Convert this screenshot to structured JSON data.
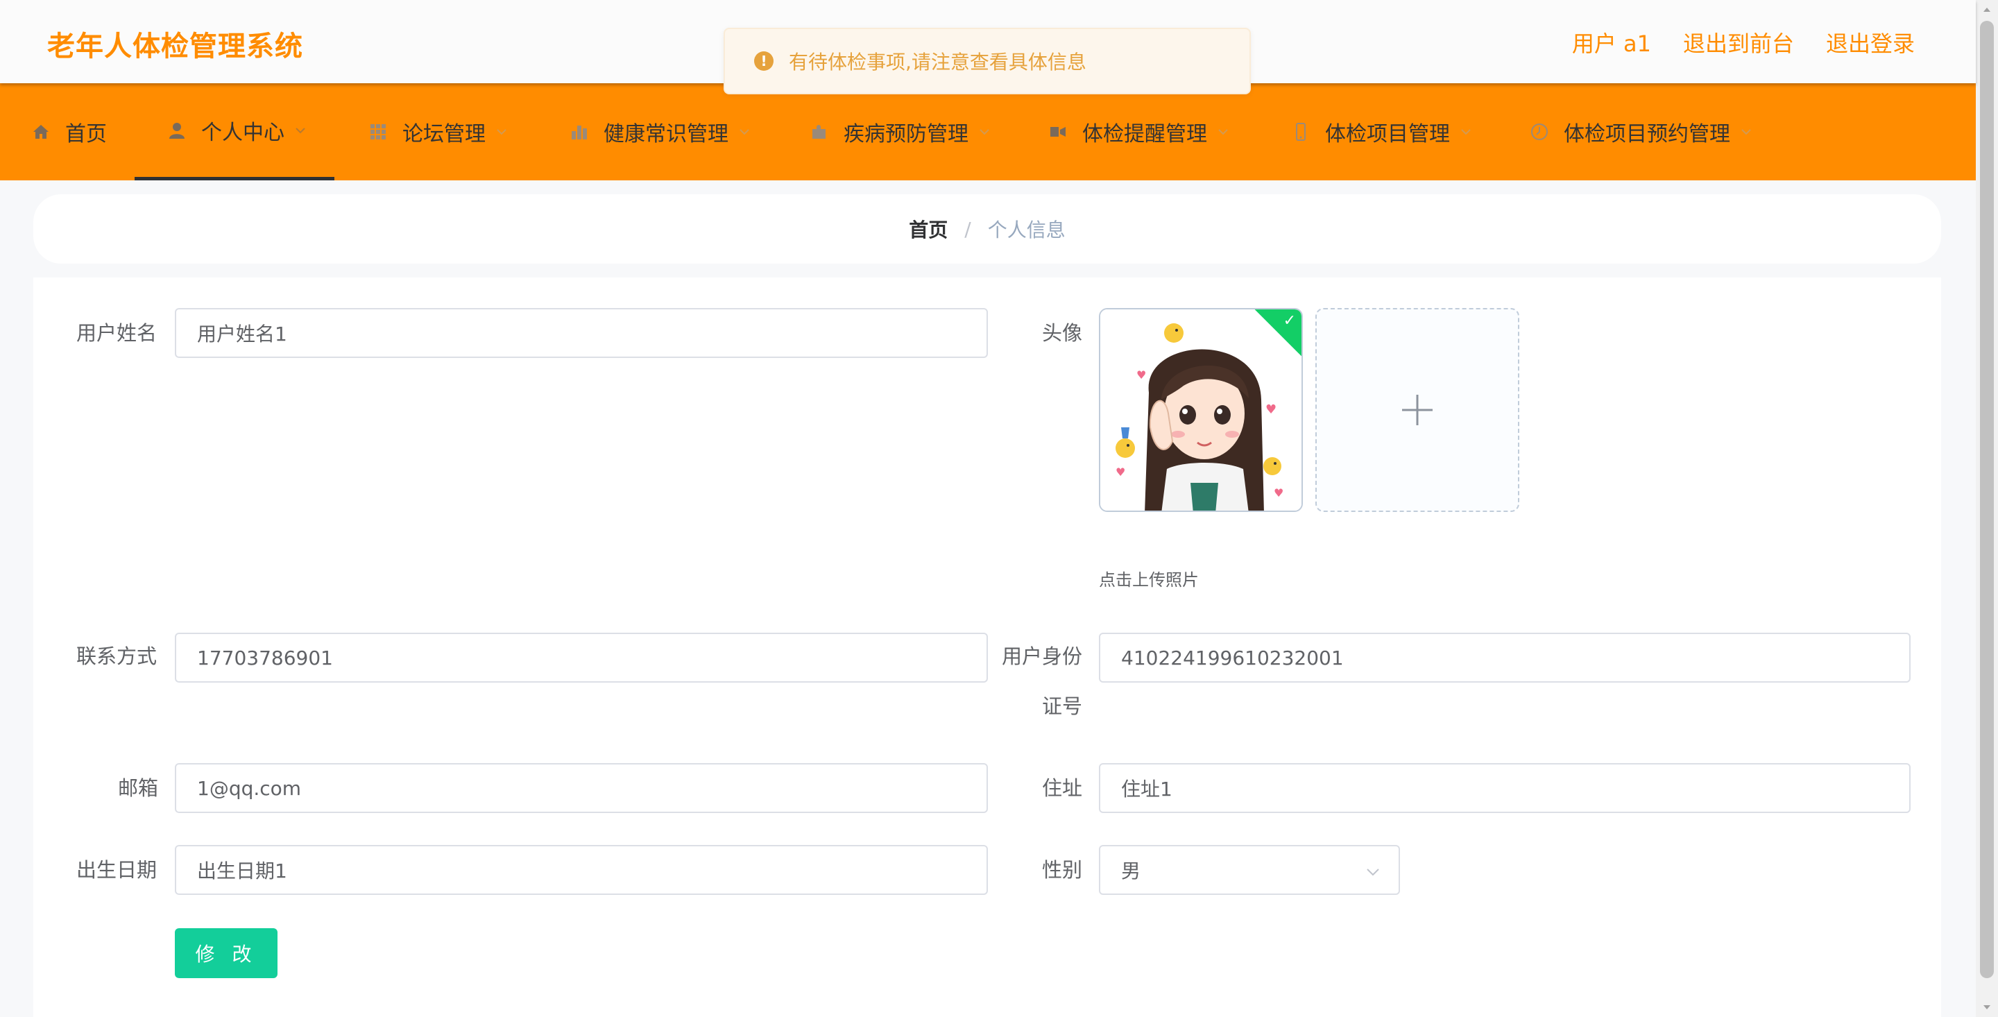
{
  "header": {
    "title": "老年人体检管理系统",
    "user_label": "用户 a1",
    "front_label": "退出到前台",
    "logout_label": "退出登录"
  },
  "toast": {
    "icon": "warning-icon",
    "text": "有待体检事项,请注意查看具体信息"
  },
  "nav": {
    "items": [
      {
        "label": "首页",
        "icon": "home-icon"
      },
      {
        "label": "个人中心",
        "icon": "user-icon"
      },
      {
        "label": "论坛管理",
        "icon": "grid-icon"
      },
      {
        "label": "健康常识管理",
        "icon": "chart-icon"
      },
      {
        "label": "疾病预防管理",
        "icon": "puzzle-icon"
      },
      {
        "label": "体检提醒管理",
        "icon": "bell-icon"
      },
      {
        "label": "体检项目管理",
        "icon": "phone-icon"
      },
      {
        "label": "体检项目预约管理",
        "icon": "clock-icon"
      }
    ]
  },
  "breadcrumb": {
    "home": "首页",
    "separator": "/",
    "current": "个人信息"
  },
  "form": {
    "name_label": "用户姓名",
    "name_value": "用户姓名1",
    "avatar_label": "头像",
    "upload_hint": "点击上传照片",
    "phone_label": "联系方式",
    "phone_value": "17703786901",
    "id_label_line1": "用户身份",
    "id_label_line2": "证号",
    "id_value": "410224199610232001",
    "email_label": "邮箱",
    "email_value": "1@qq.com",
    "address_label": "住址",
    "address_value": "住址1",
    "birth_label": "出生日期",
    "birth_value": "出生日期1",
    "gender_label": "性别",
    "gender_value": "男",
    "submit_label": "修 改"
  },
  "colors": {
    "brand": "#ff8c00",
    "success": "#13ce66",
    "button": "#13ce9a",
    "warning": "#e6a23c"
  }
}
